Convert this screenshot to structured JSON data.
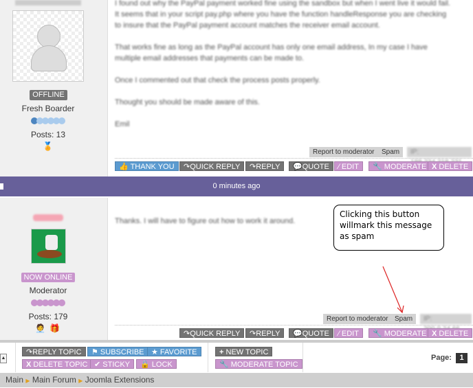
{
  "posts": [
    {
      "status": "OFFLINE",
      "rank": "Fresh Boarder",
      "posts": "Posts: 13",
      "rank_color": "#5b9bd0",
      "message": [
        "I found out why the PayPal payment worked fine using the sandbox but when I went live it would fail.\nIt seems that in your script pay.php where you have the function handleResponse you are checking to insure that the PayPal payment account matches the receiver email account.",
        "That works fine as long as the PayPal account has only one email address, In my case I have multiple email addresses that payments can be made to.",
        "Once I commented out that check the process posts properly.",
        "Thought you should be made aware of this.",
        "Emil"
      ],
      "report": "Report to moderator",
      "spam": "Spam",
      "ip": "IP: 188.234.218.231",
      "buttons": [
        "THANK YOU",
        "QUICK REPLY",
        "REPLY",
        "QUOTE",
        "EDIT",
        "MODERATE",
        "DELETE"
      ]
    },
    {
      "status": "NOW ONLINE",
      "rank": "Moderator",
      "posts": "Posts: 179",
      "rank_color": "#c995cd",
      "message": [
        "Thanks. I will have to figure out how to work it around."
      ],
      "report": "Report to moderator",
      "spam": "Spam",
      "ip": "IP: 200.0.24.66",
      "buttons": [
        "QUICK REPLY",
        "REPLY",
        "QUOTE",
        "EDIT",
        "MODERATE",
        "DELETE"
      ]
    }
  ],
  "time_bar": "0 minutes ago",
  "callout": "Clicking this button willmark this message as spam",
  "toolbar": {
    "reply_topic": "REPLY TOPIC",
    "subscribe": "SUBSCRIBE",
    "favorite": "FAVORITE",
    "delete_topic": "DELETE TOPIC",
    "sticky": "STICKY",
    "lock": "LOCK",
    "new_topic": "NEW TOPIC",
    "moderate_topic": "MODERATE TOPIC",
    "page_label": "Page:",
    "page": "1"
  },
  "breadcrumb": [
    "Main",
    "Main Forum",
    "Joomla Extensions"
  ],
  "colors": {
    "bar": "#67609a",
    "gray_btn": "#737373",
    "blue_btn": "#5b9bd0",
    "pink_btn": "#c995cd"
  }
}
